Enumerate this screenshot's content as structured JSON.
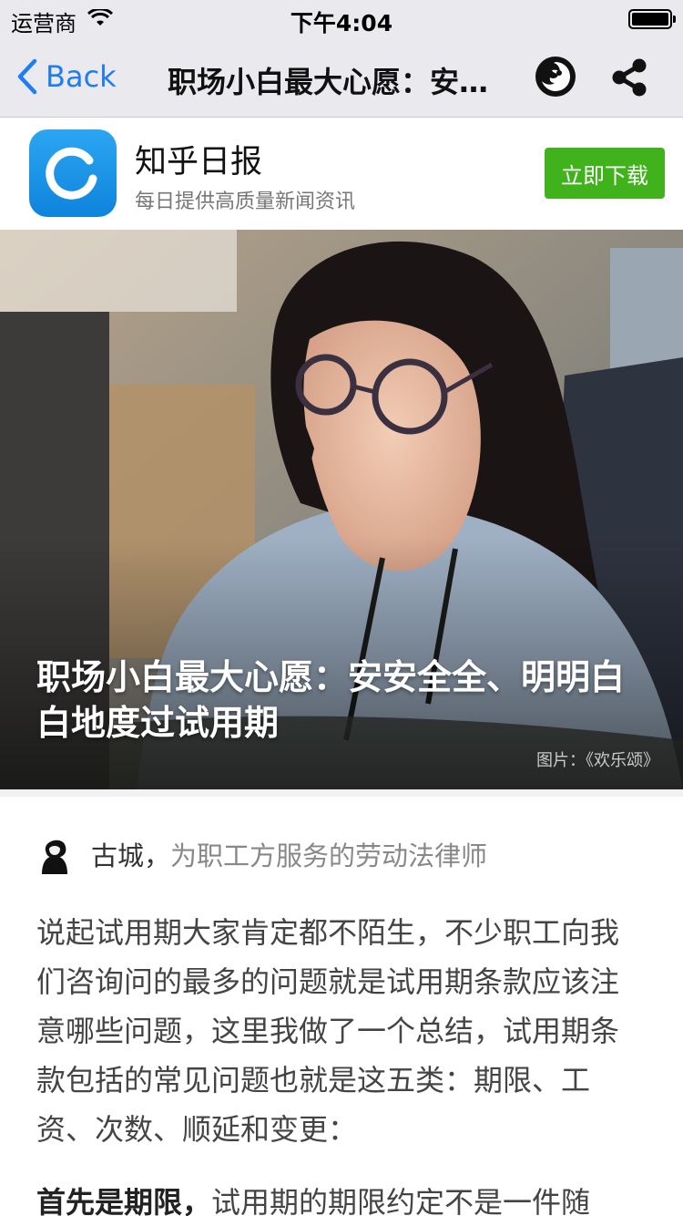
{
  "status_bar": {
    "carrier": "运营商",
    "time": "下午4:04"
  },
  "nav": {
    "back_label": "Back",
    "title": "职场小白最大心愿：安安全全、明明白白地度过试用期"
  },
  "app_banner": {
    "name": "知乎日报",
    "description": "每日提供高质量新闻资讯",
    "download_label": "立即下载"
  },
  "hero": {
    "title": "职场小白最大心愿：安安全全、明明白白地度过试用期",
    "credit": "图片：《欢乐颂》"
  },
  "author": {
    "name": "古城，",
    "bio": "为职工方服务的劳动法律师"
  },
  "article": {
    "paragraph_1": "说起试用期大家肯定都不陌生，不少职工向我们咨询问的最多的问题就是试用期条款应该注意哪些问题，这里我做了一个总结，试用期条款包括的常见问题也就是这五类：期限、工资、次数、顺延和变更：",
    "paragraph_2_lead": "首先是期限，",
    "paragraph_2_body": "试用期的期限约定不是一件随"
  },
  "colors": {
    "nav_background": "#e9e9ee",
    "link_blue": "#1f7cf7",
    "download_green": "#3fb21c",
    "app_icon_blue": "#1a95e8"
  }
}
